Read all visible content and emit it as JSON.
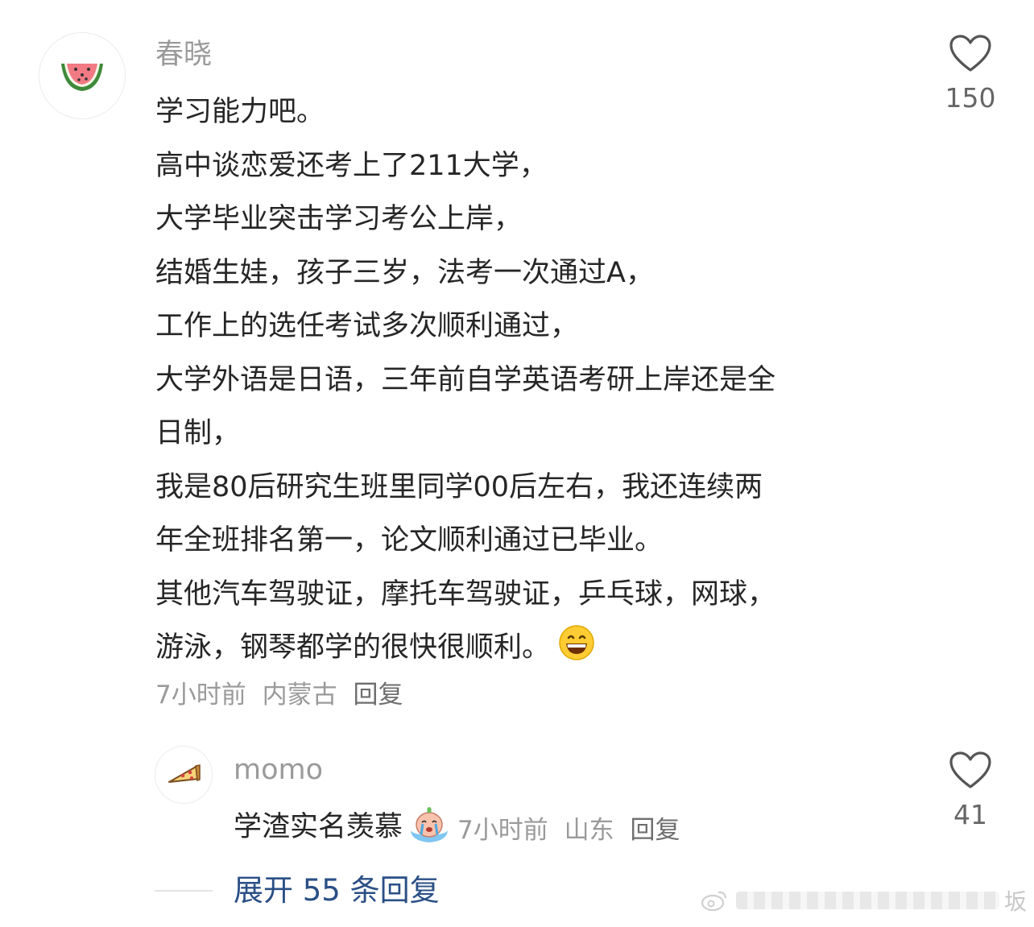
{
  "main_comment": {
    "username": "春晓",
    "avatar_icon": "watermelon-icon",
    "lines": [
      "学习能力吧。",
      "高中谈恋爱还考上了211大学，",
      "大学毕业突击学习考公上岸，",
      "结婚生娃，孩子三岁，法考一次通过A，",
      "工作上的选任考试多次顺利通过，",
      "大学外语是日语，三年前自学英语考研上岸还是全",
      "日制，",
      "我是80后研究生班里同学00后左右，我还连续两",
      "年全班排名第一，论文顺利通过已毕业。",
      "其他汽车驾驶证，摩托车驾驶证，乒乓球，网球，",
      "游泳，钢琴都学的很快很顺利。"
    ],
    "trailing_emoji": "grinning-face-emoji",
    "time": "7小时前",
    "location": "内蒙古",
    "reply_label": "回复",
    "like_count": "150"
  },
  "reply": {
    "username": "momo",
    "avatar_icon": "pizza-slice-icon",
    "text": "学渣实名羡慕",
    "sticker": "crying-peach-sticker",
    "time": "7小时前",
    "location": "山东",
    "reply_label": "回复",
    "like_count": "41"
  },
  "expand_label": "展开 55 条回复",
  "watermark_char": "坂",
  "colors": {
    "muted": "#9a9a9a",
    "link_blue": "#2a4f86",
    "text": "#262626"
  }
}
